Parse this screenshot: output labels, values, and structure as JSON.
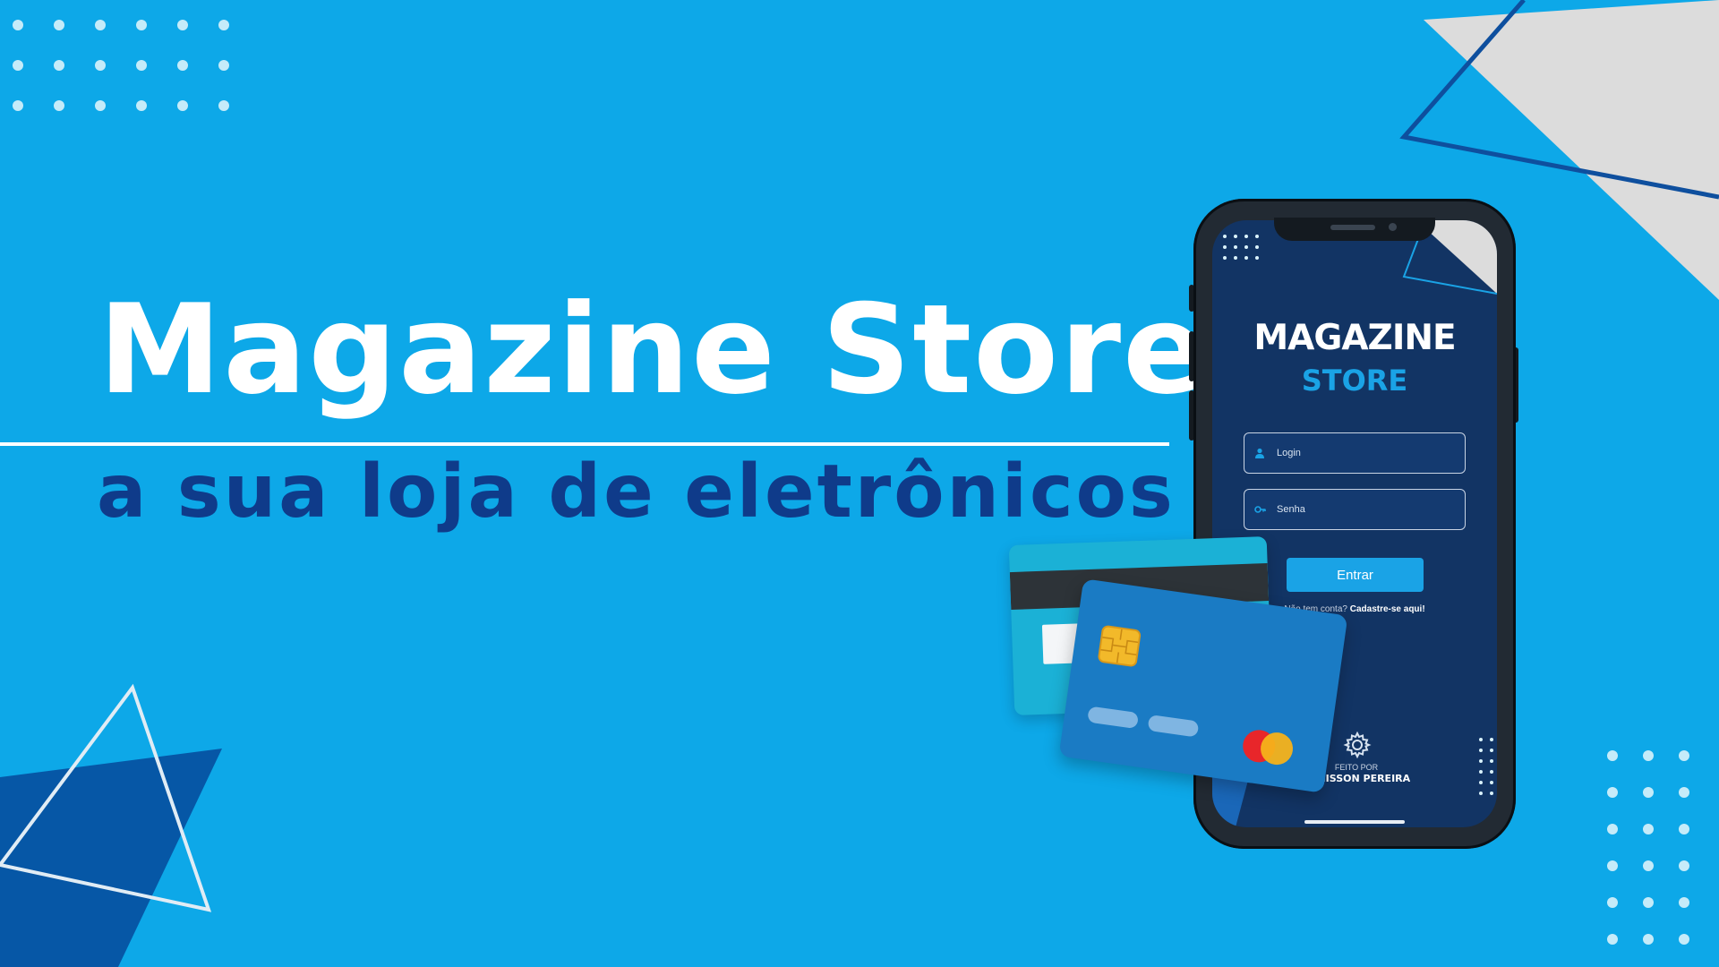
{
  "hero": {
    "title": "Magazine Store",
    "subtitle": "a sua loja de eletrônicos"
  },
  "app": {
    "logo_line1": "MAGAZINE",
    "logo_line2": "STORE",
    "login_placeholder": "Login",
    "password_placeholder": "Senha",
    "enter_label": "Entrar",
    "no_account_text": "Não tem conta?",
    "signup_link": "Cadastre-se aqui!",
    "made_by_label": "FEITO POR",
    "author_name": "DENISSON PEREIRA"
  },
  "icons": {
    "user": "user-icon",
    "key": "key-icon",
    "gear": "gear-icon",
    "chip": "card-chip-icon",
    "mastercard": "mastercard-logo-icon"
  },
  "colors": {
    "background": "#0da8e8",
    "accent": "#1aa3e6",
    "navy": "#0f3b8a",
    "app_bg": "#123464"
  }
}
